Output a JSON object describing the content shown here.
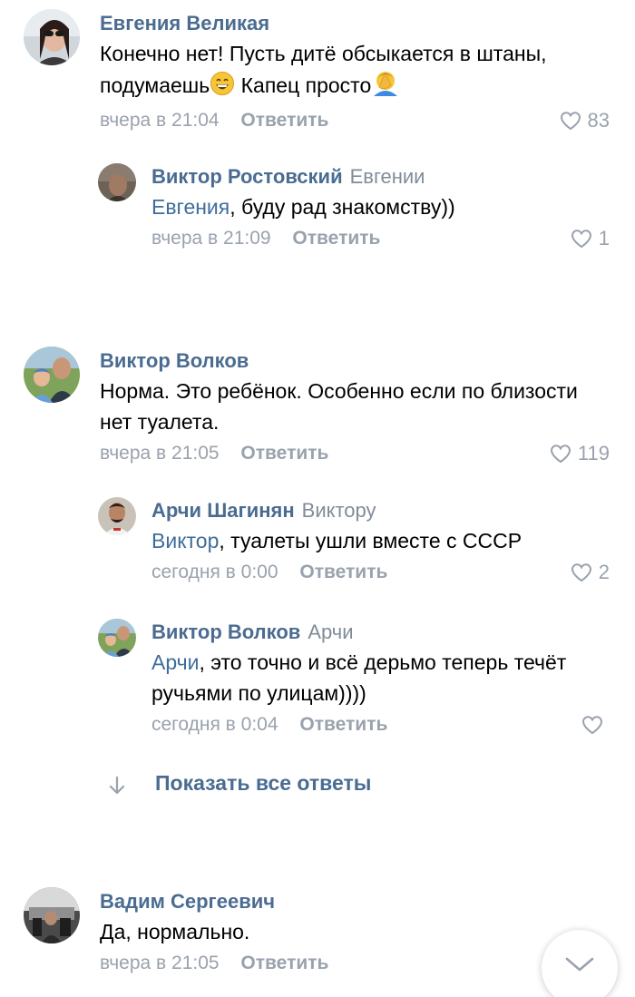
{
  "comments": [
    {
      "author": "Евгения Великая",
      "text": "Конечно нет! Пусть дитё обсыкается в штаны, подумаешь",
      "text_tail": "Капец просто",
      "time": "вчера в 21:04",
      "reply_label": "Ответить",
      "likes": "83"
    },
    {
      "author": "Виктор Ростовский",
      "reply_to": "Евгении",
      "mention": "Евгения",
      "text": ", буду рад знакомству))",
      "time": "вчера в 21:09",
      "reply_label": "Ответить",
      "likes": "1"
    },
    {
      "author": "Виктор Волков",
      "text": "Норма. Это ребёнок. Особенно если по близости нет туалета.",
      "time": "вчера в 21:05",
      "reply_label": "Ответить",
      "likes": "119"
    },
    {
      "author": "Арчи Шагинян",
      "reply_to": "Виктору",
      "mention": "Виктор",
      "text": ", туалеты ушли вместе с СССР",
      "time": "сегодня в 0:00",
      "reply_label": "Ответить",
      "likes": "2"
    },
    {
      "author": "Виктор Волков",
      "reply_to": "Арчи",
      "mention": "Арчи",
      "text": ", это точно и всё дерьмо теперь течёт ручьями по улицам))))",
      "time": "сегодня в 0:04",
      "reply_label": "Ответить",
      "likes": ""
    },
    {
      "author": "Вадим Сергеевич",
      "text": "Да, нормально.",
      "time": "вчера в 21:05",
      "reply_label": "Ответить",
      "likes": ""
    }
  ],
  "show_all_replies": "Показать все ответы",
  "icons": {
    "like": "heart-outline-icon",
    "arrow": "arrow-down-icon",
    "scroll": "chevron-down-icon",
    "emoji1": "grinning-face-emoji",
    "emoji2": "facepalm-emoji"
  },
  "colors": {
    "author": "#4a6c91",
    "meta": "#99a2ad",
    "mention": "#3f6d9b"
  }
}
